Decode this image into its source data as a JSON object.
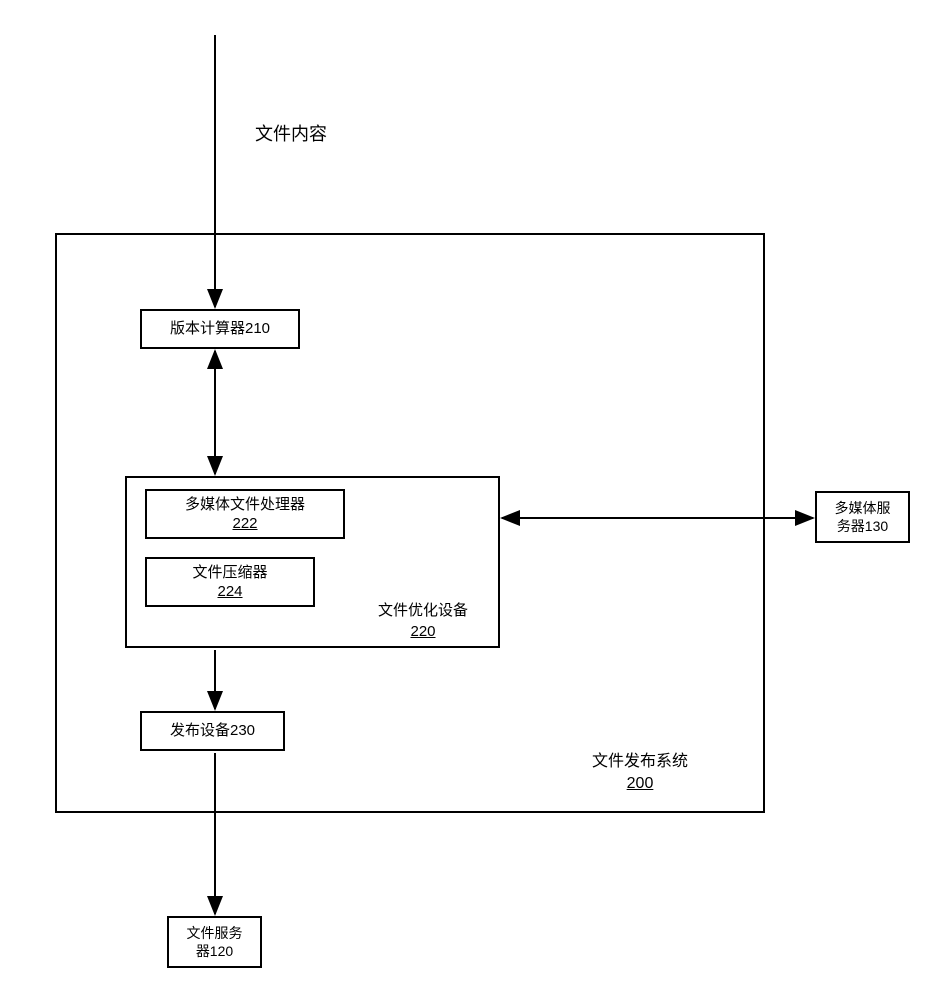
{
  "labels": {
    "file_content": "文件内容"
  },
  "nodes": {
    "version_calculator": "版本计算器210",
    "multimedia_processor": {
      "line1": "多媒体文件处理器",
      "line2": "222"
    },
    "file_compressor": {
      "line1": "文件压缩器",
      "line2": "224"
    },
    "file_optimizer": {
      "line1": "文件优化设备",
      "line2": "220"
    },
    "publish_device": "发布设备230",
    "multimedia_server": {
      "line1": "多媒体服",
      "line2": "务器130"
    },
    "file_server": {
      "line1": "文件服务",
      "line2": "器120"
    }
  },
  "system": {
    "name": "文件发布系统",
    "id": "200"
  }
}
